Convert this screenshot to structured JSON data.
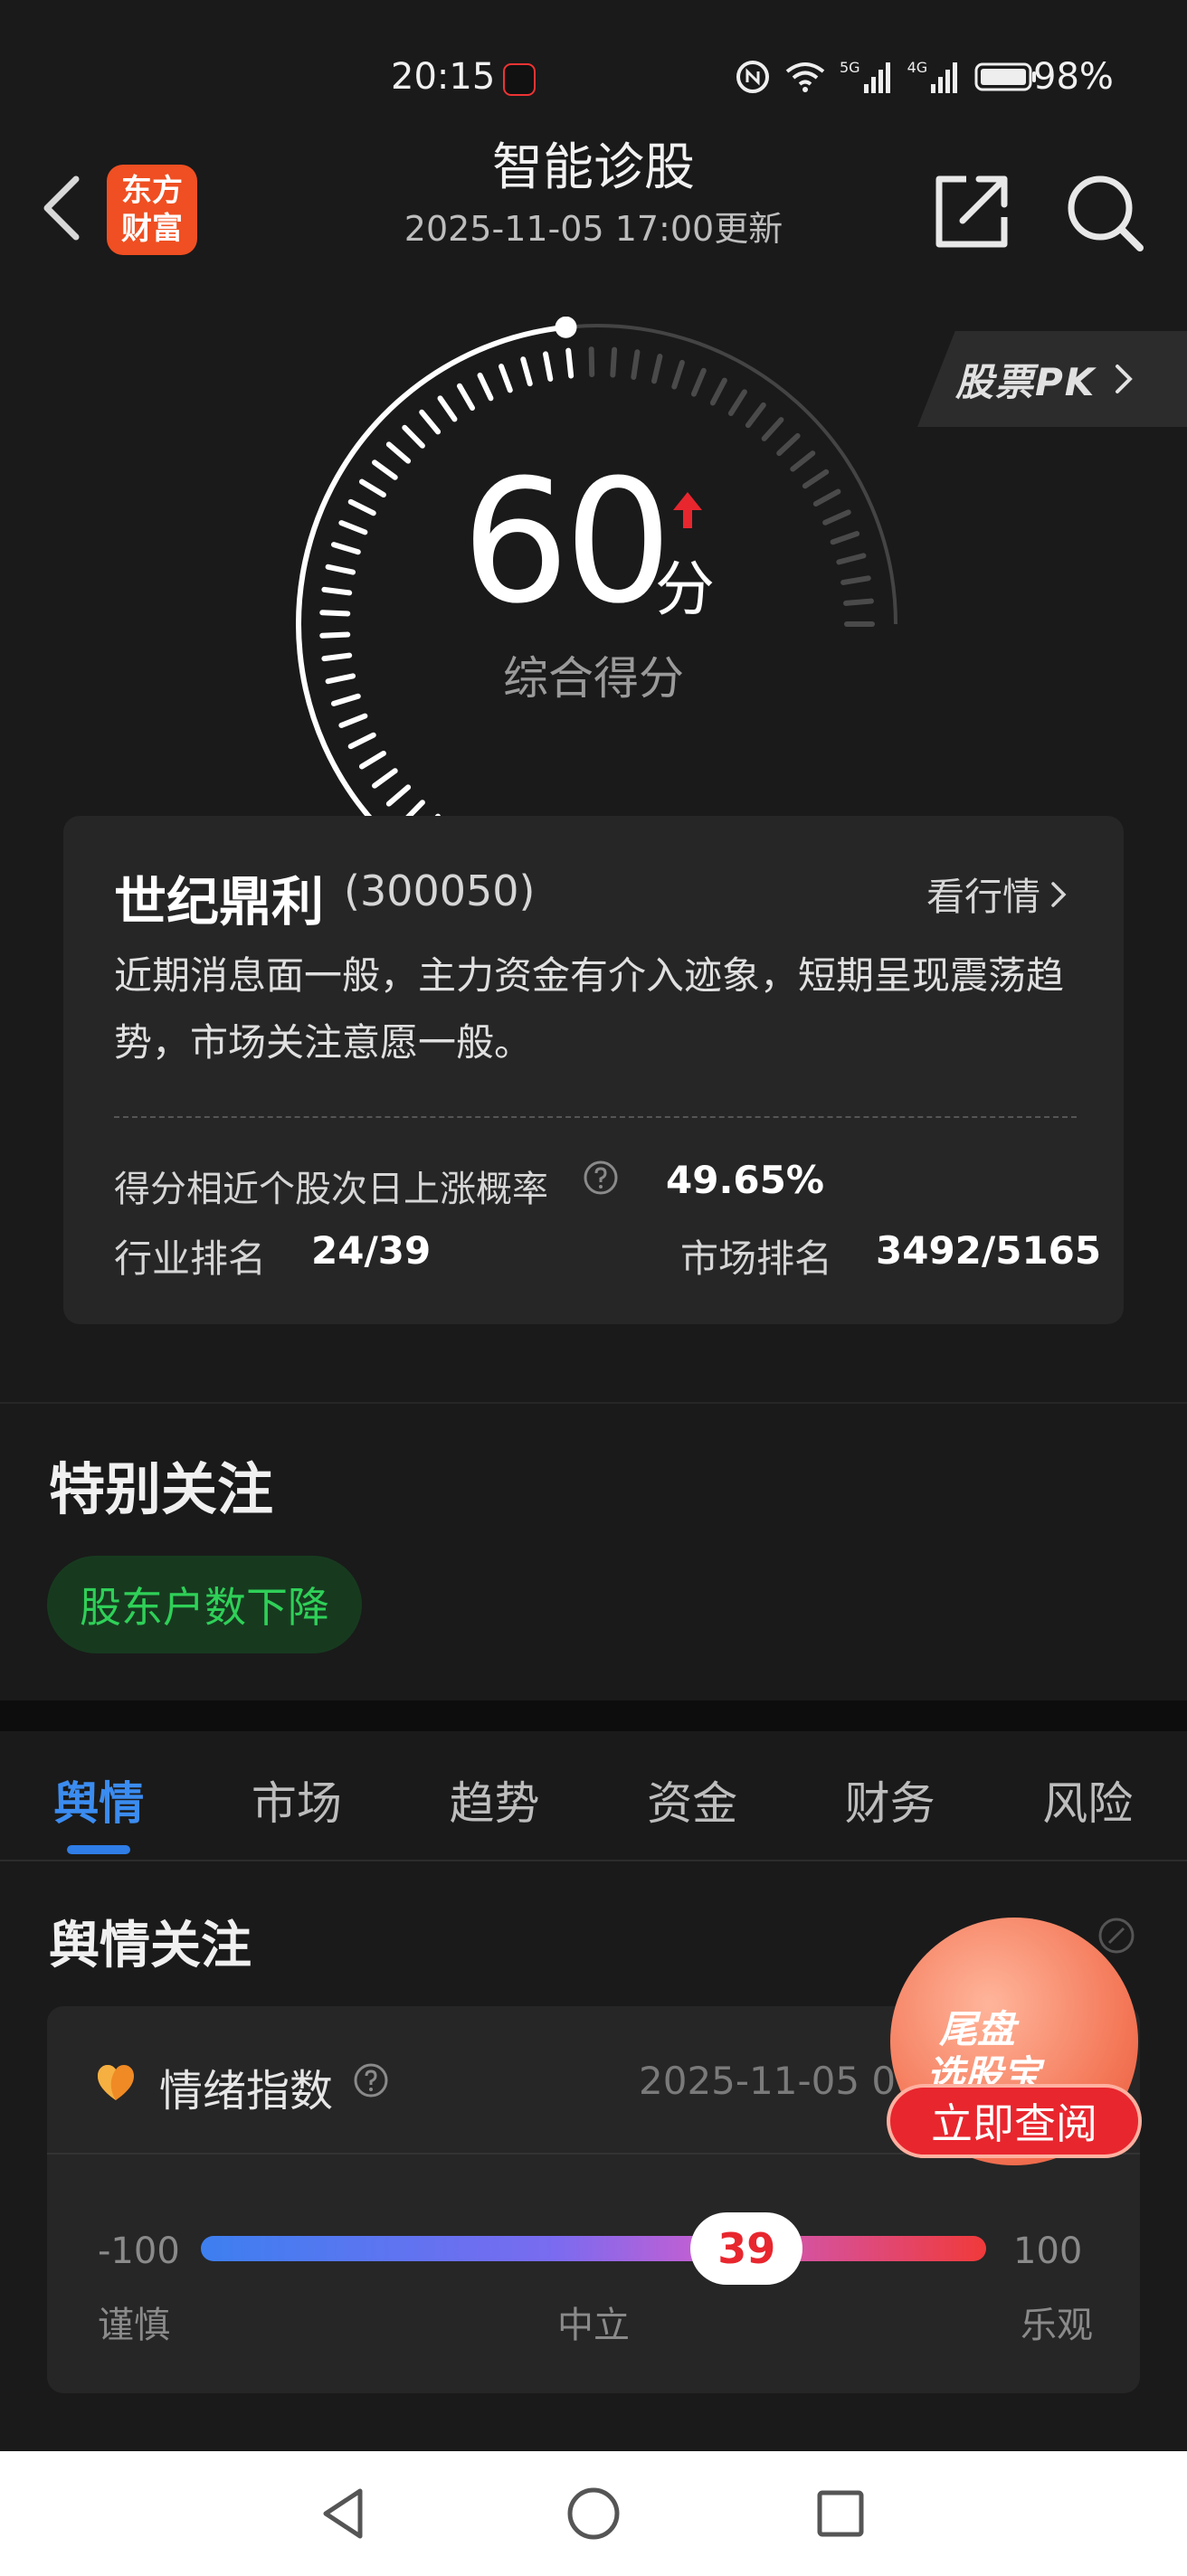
{
  "status_bar": {
    "time": "20:15",
    "battery": "98%",
    "network_a": "5G",
    "network_b": "4G"
  },
  "nav": {
    "logo_line1": "东方",
    "logo_line2": "财富",
    "title": "智能诊股",
    "subtitle": "2025-11-05 17:00更新"
  },
  "score": {
    "value": 60,
    "value_text": "60",
    "unit": "分",
    "label": "综合得分",
    "max": 100,
    "trend": "up"
  },
  "pk_button": "股票PK",
  "stock": {
    "name": "世纪鼎利",
    "code": "(300050)",
    "market_link": "看行情",
    "description": "近期消息面一般，主力资金有介入迹象，短期呈现震荡趋势，市场关注意愿一般。",
    "prob_label": "得分相近个股次日上涨概率",
    "prob_value": "49.65%",
    "industry_label": "行业排名",
    "industry_value": "24/39",
    "market_label": "市场排名",
    "market_value": "3492/5165"
  },
  "special": {
    "title": "特别关注",
    "tag": "股东户数下降"
  },
  "tabs": [
    {
      "label": "舆情",
      "active": true
    },
    {
      "label": "市场",
      "active": false
    },
    {
      "label": "趋势",
      "active": false
    },
    {
      "label": "资金",
      "active": false
    },
    {
      "label": "财务",
      "active": false
    },
    {
      "label": "风险",
      "active": false
    }
  ],
  "sentiment": {
    "section_title": "舆情关注",
    "label": "情绪指数",
    "date": "2025-11-05 0",
    "min": "-100",
    "max": "100",
    "value": 39,
    "value_text": "39",
    "left_label": "谨慎",
    "mid_label": "中立",
    "right_label": "乐观"
  },
  "promo": {
    "line1": "尾盘",
    "line2": "选股宝",
    "button": "立即查阅"
  },
  "icons": {
    "back": "chevron-left-icon",
    "share": "share-icon",
    "search": "search-icon",
    "help": "question-circle-icon",
    "heart": "heart-icon"
  },
  "colors": {
    "background": "#1a1a1a",
    "card": "#262626",
    "accent_blue": "#3b8cf0",
    "up_red": "#e8262e",
    "tag_green": "#2fd058",
    "logo_orange": "#ef4f22"
  }
}
